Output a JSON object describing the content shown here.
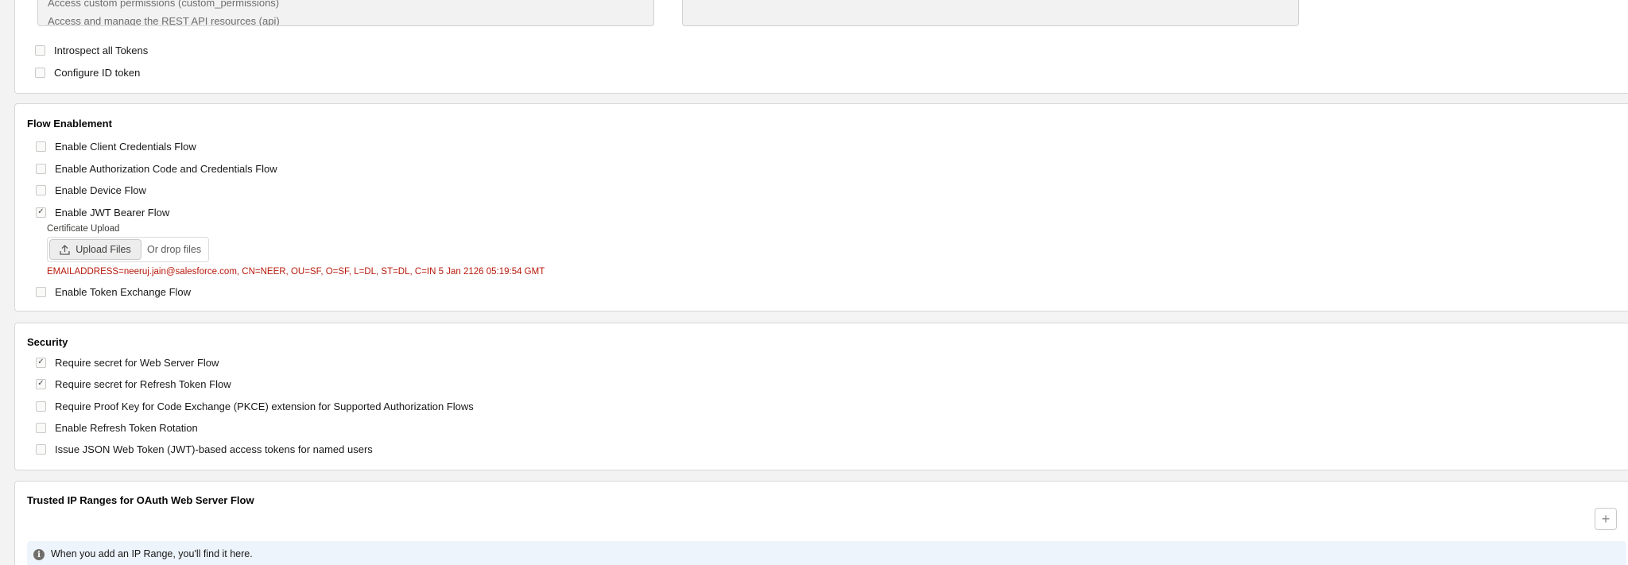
{
  "top": {
    "scopes_available": [
      "Access custom permissions (custom_permissions)",
      "Access and manage the REST API resources (api)"
    ],
    "checkboxes": [
      {
        "label": "Introspect all Tokens",
        "checked": false
      },
      {
        "label": "Configure ID token",
        "checked": false
      }
    ]
  },
  "flow": {
    "title": "Flow Enablement",
    "checkboxes": [
      {
        "label": "Enable Client Credentials Flow",
        "checked": false
      },
      {
        "label": "Enable Authorization Code and Credentials Flow",
        "checked": false
      },
      {
        "label": "Enable Device Flow",
        "checked": false
      },
      {
        "label": "Enable JWT Bearer Flow",
        "checked": true
      }
    ],
    "certificate_label": "Certificate Upload",
    "upload_button": "Upload Files",
    "drop_text": "Or drop files",
    "certificate_info": "EMAILADDRESS=neeruj.jain@salesforce.com, CN=NEER, OU=SF, O=SF, L=DL, ST=DL, C=IN 5 Jan 2126 05:19:54 GMT",
    "token_exchange": {
      "label": "Enable Token Exchange Flow",
      "checked": false
    }
  },
  "security": {
    "title": "Security",
    "checkboxes": [
      {
        "label": "Require secret for Web Server Flow",
        "checked": true
      },
      {
        "label": "Require secret for Refresh Token Flow",
        "checked": true
      },
      {
        "label": "Require Proof Key for Code Exchange (PKCE) extension for Supported Authorization Flows",
        "checked": false
      },
      {
        "label": "Enable Refresh Token Rotation",
        "checked": false
      },
      {
        "label": "Issue JSON Web Token (JWT)-based access tokens for named users",
        "checked": false
      }
    ]
  },
  "trusted_ip": {
    "title": "Trusted IP Ranges for OAuth Web Server Flow",
    "add_symbol": "+",
    "info_icon": "i",
    "empty_message": "When you add an IP Range, you'll find it here."
  }
}
